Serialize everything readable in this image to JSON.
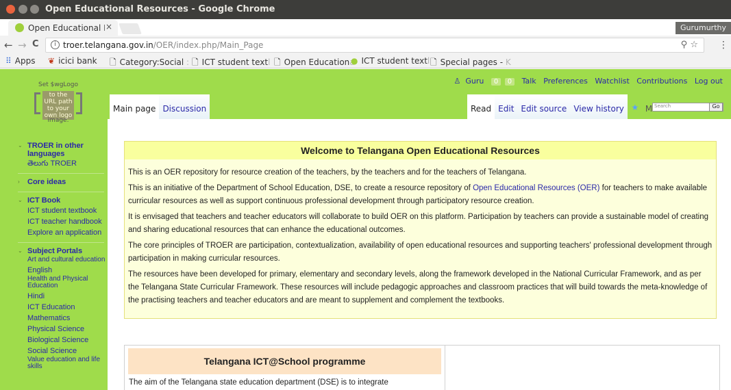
{
  "window": {
    "title": "Open Educational Resources - Google Chrome",
    "tab_label": "Open Educational F",
    "tab_close": "×",
    "profile": "Gurumurthy"
  },
  "toolbar": {
    "back": "←",
    "forward": "→",
    "reload": "C",
    "url_host": "troer.telangana.gov.in",
    "url_path": "/OER/index.php/Main_Page",
    "zoom_icon": "⚲",
    "star_icon": "☆",
    "menu_icon": "⋮"
  },
  "bookmarks": [
    {
      "icon": "apps-grid-icon",
      "glyph": "⠿",
      "label": "Apps",
      "fade": ""
    },
    {
      "icon": "icici-logo-icon",
      "glyph": "❦",
      "label": "icici bank",
      "fade": ""
    },
    {
      "icon": "page-icon",
      "glyph": "🗋",
      "label": "Category:Social",
      "fade": " :"
    },
    {
      "icon": "page-icon",
      "glyph": "🗋",
      "label": "ICT student text",
      "fade": "l"
    },
    {
      "icon": "page-icon",
      "glyph": "🗋",
      "label": "Open Education",
      "fade": "a"
    },
    {
      "icon": "site-icon",
      "glyph": "●",
      "label": "ICT student text",
      "fade": "l"
    },
    {
      "icon": "page-icon",
      "glyph": "🗋",
      "label": "Special pages -",
      "fade": " K"
    }
  ],
  "wiki": {
    "logo_top": "Set $wgLogo",
    "logo_mid": "to the URL path to your own logo",
    "logo_bottom": "image.",
    "personal": {
      "user": "Guru",
      "alerts": "0",
      "notices": "0",
      "talk": "Talk",
      "preferences": "Preferences",
      "watchlist": "Watchlist",
      "contributions": "Contributions",
      "logout": "Log out"
    },
    "tabs_left": {
      "main": "Main page",
      "discussion": "Discussion"
    },
    "tabs_right": {
      "read": "Read",
      "edit": "Edit",
      "edit_source": "Edit source",
      "view_history": "View history",
      "star": "★",
      "more": "More ▾"
    },
    "search": {
      "placeholder": "Search",
      "go": "Go"
    }
  },
  "sidebar": {
    "languages_head": "TROER in other languages",
    "languages_link": "తెలుగు TROER",
    "core_ideas": "Core ideas",
    "ict_book_head": "ICT Book",
    "ict_book_links": [
      "ICT student textbook",
      "ICT teacher handbook",
      "Explore an application"
    ],
    "subject_head": "Subject Portals",
    "subject_links": [
      "Art and cultural education",
      "English",
      "Health and Physical Education",
      "Hindi",
      "ICT Education",
      "Mathematics",
      "Physical Science",
      "Biological Science",
      "Social Science",
      "Value education and life skills"
    ]
  },
  "content": {
    "welcome_title": "Welcome to Telangana Open Educational Resources",
    "p1": "This is an OER repository for resource creation of the teachers, by the teachers and for the teachers of Telangana.",
    "p2_a": "This is an initiative of the Department of School Education, DSE, to create a resource repository of ",
    "p2_link": "Open Educational Resources (OER)",
    "p2_b": " for teachers to make available curricular resources as well as support continuous professional development through participatory resource creation.",
    "p3": "It is envisaged that teachers and teacher educators will collaborate to build OER on this platform. Participation by teachers can provide a sustainable model of creating and sharing educational resources that can enhance the educational outcomes.",
    "p4": "The core principles of TROER are participation, contextualization, availability of open educational resources and supporting teachers' professional development through participation in making curricular resources.",
    "p5": "The resources have been developed for primary, elementary and secondary levels, along the framework developed in the National Curricular Framework, and as per the Telangana State Curricular Framework. These resources will include pedagogic approaches and classroom practices that will build towards the meta-knowledge of the practising teachers and teacher educators and are meant to supplement and complement the textbooks.",
    "ict_title": "Telangana ICT@School programme",
    "ict_text": "The aim of the Telangana state education department (DSE) is to integrate"
  },
  "colors": {
    "page_bg": "#9fdc4b",
    "link": "#2a28a8",
    "welcome_bg": "#fdffdc",
    "welcome_head_bg": "#f9ff9e",
    "ict_head_bg": "#fde3c5"
  }
}
